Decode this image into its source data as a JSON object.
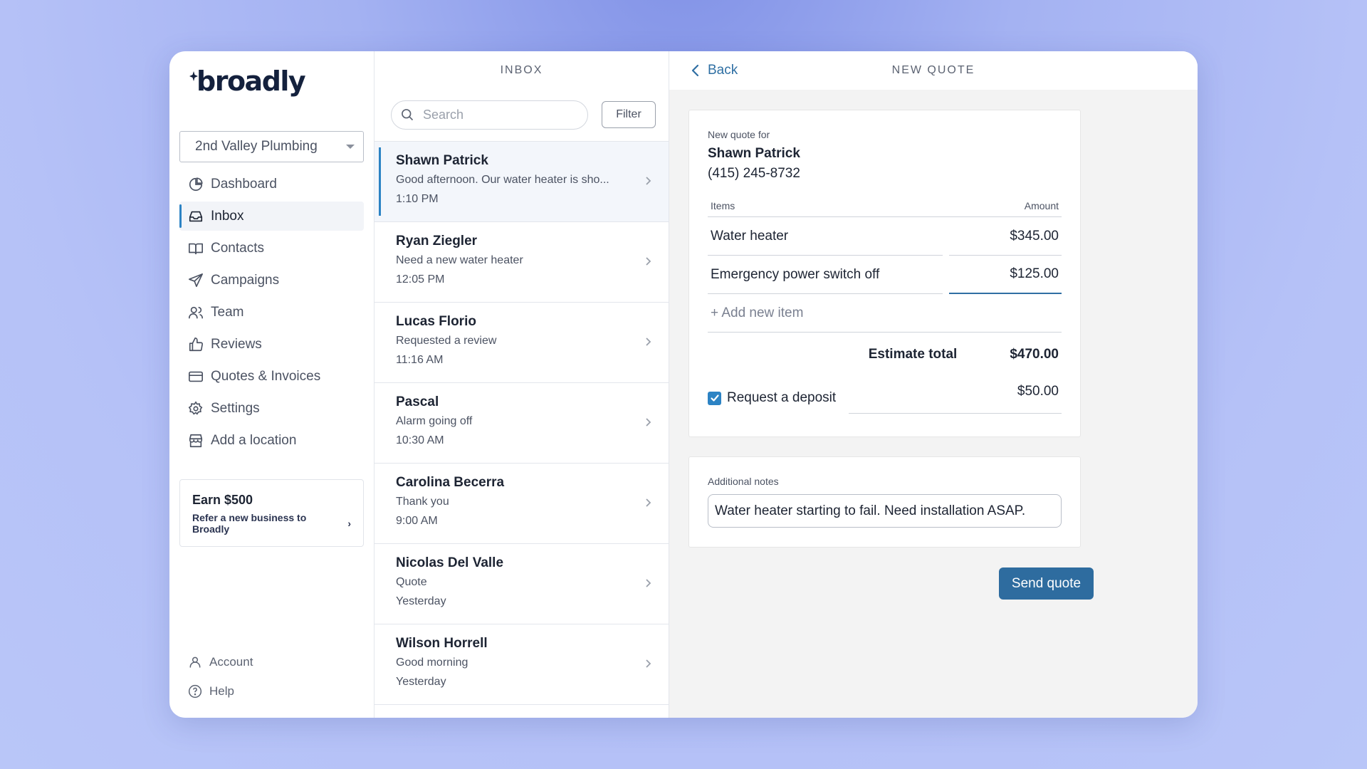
{
  "brand": {
    "logo_text": "broadly"
  },
  "sidebar": {
    "location": "2nd Valley Plumbing",
    "items": [
      {
        "label": "Dashboard",
        "icon": "pie-chart-icon",
        "active": false
      },
      {
        "label": "Inbox",
        "icon": "inbox-icon",
        "active": true
      },
      {
        "label": "Contacts",
        "icon": "book-icon",
        "active": false
      },
      {
        "label": "Campaigns",
        "icon": "send-icon",
        "active": false
      },
      {
        "label": "Team",
        "icon": "users-icon",
        "active": false
      },
      {
        "label": "Reviews",
        "icon": "thumbs-up-icon",
        "active": false
      },
      {
        "label": "Quotes & Invoices",
        "icon": "credit-card-icon",
        "active": false
      },
      {
        "label": "Settings",
        "icon": "gear-icon",
        "active": false
      },
      {
        "label": "Add a location",
        "icon": "store-icon",
        "active": false
      }
    ],
    "earn": {
      "title": "Earn $500",
      "link": "Refer a new business to Broadly"
    },
    "bottom": {
      "account": "Account",
      "help": "Help"
    }
  },
  "inbox": {
    "title": "INBOX",
    "search_placeholder": "Search",
    "filter_label": "Filter",
    "conversations": [
      {
        "name": "Shawn Patrick",
        "message": "Good afternoon. Our water heater is sho...",
        "time": "1:10 PM",
        "active": true
      },
      {
        "name": "Ryan Ziegler",
        "message": "Need a new water heater",
        "time": "12:05 PM",
        "active": false
      },
      {
        "name": "Lucas Florio",
        "message": "Requested a review",
        "time": "11:16 AM",
        "active": false
      },
      {
        "name": "Pascal",
        "message": "Alarm going off",
        "time": "10:30 AM",
        "active": false
      },
      {
        "name": "Carolina Becerra",
        "message": "Thank you",
        "time": "9:00 AM",
        "active": false
      },
      {
        "name": "Nicolas Del Valle",
        "message": "Quote",
        "time": "Yesterday",
        "active": false
      },
      {
        "name": "Wilson Horrell",
        "message": "Good morning",
        "time": "Yesterday",
        "active": false
      }
    ]
  },
  "quote": {
    "back_label": "Back",
    "title": "NEW QUOTE",
    "for_label": "New quote for",
    "customer_name": "Shawn Patrick",
    "customer_phone": "(415) 245-8732",
    "items_header": "Items",
    "amount_header": "Amount",
    "items": [
      {
        "name": "Water heater",
        "amount": "$345.00"
      },
      {
        "name": "Emergency power switch off",
        "amount": "$125.00"
      }
    ],
    "add_item_label": "+ Add new item",
    "total_label": "Estimate total",
    "total_value": "$470.00",
    "deposit_label": "Request a deposit",
    "deposit_checked": true,
    "deposit_value": "$50.00",
    "notes_label": "Additional notes",
    "notes_value": "Water heater starting to fail. Need installation ASAP.",
    "send_label": "Send quote"
  },
  "colors": {
    "accent": "#2c83c4",
    "primary_button": "#2e6c9f",
    "brand_text": "#14213d"
  }
}
